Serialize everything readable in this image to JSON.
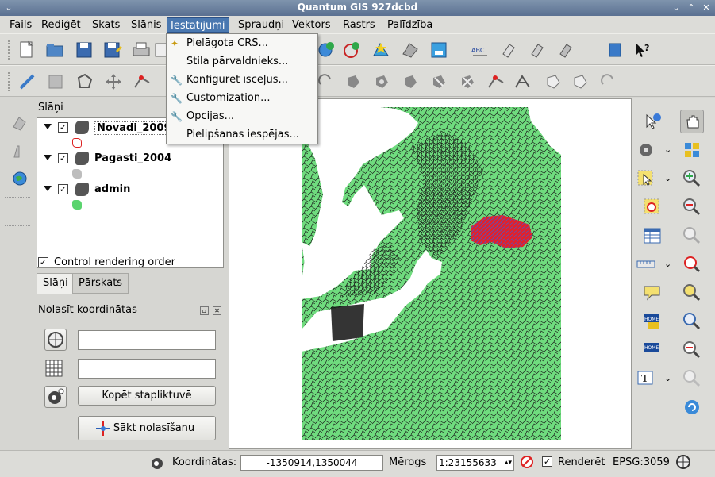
{
  "window": {
    "title": "Quantum GIS 927dcbd"
  },
  "menubar": {
    "items": [
      "Fails",
      "Rediģēt",
      "Skats",
      "Slānis",
      "Iestatījumi",
      "Spraudņi",
      "Vektors",
      "Rastrs",
      "Palīdzība"
    ],
    "active": "Iestatījumi"
  },
  "dropdown": {
    "items": [
      {
        "label": "Pielāgota CRS...",
        "icon": "wand-icon"
      },
      {
        "label": "Stila pārvaldnieks...",
        "icon": ""
      },
      {
        "label": "Konfigurēt īsceļus...",
        "icon": "wrench-icon"
      },
      {
        "label": "Customization...",
        "icon": "wrench-icon"
      },
      {
        "label": "Opcijas...",
        "icon": "wrench-icon"
      },
      {
        "label": "Pielipšanas iespējas...",
        "icon": ""
      }
    ]
  },
  "layers_panel": {
    "title": "Slāņi",
    "layers": [
      {
        "name": "Novadi_2009",
        "checked": true,
        "swatch_color": "#f5f5f5"
      },
      {
        "name": "Pagasti_2004",
        "checked": true,
        "swatch_color": "#bdbdbd"
      },
      {
        "name": "admin",
        "checked": true,
        "swatch_color": "#5ad46e"
      }
    ],
    "control_rendering_order": "Control rendering order",
    "tabs": [
      "Slāņi",
      "Pārskats"
    ]
  },
  "coord_panel": {
    "title": "Nolasīt koordinātas",
    "copy_button": "Kopēt stapliktuvē",
    "start_button": "Sākt nolasīšanu"
  },
  "statusbar": {
    "coord_label": "Koordinātas:",
    "coord_value": "-1350914,1350044",
    "scale_label": "Mērogs",
    "scale_value": "1:23155633",
    "render_label": "Renderēt",
    "epsg": "EPSG:3059"
  },
  "colors": {
    "map_land": "#6fdc7e",
    "map_highlight": "#e2202a",
    "menu_active": "#4a78b0"
  }
}
